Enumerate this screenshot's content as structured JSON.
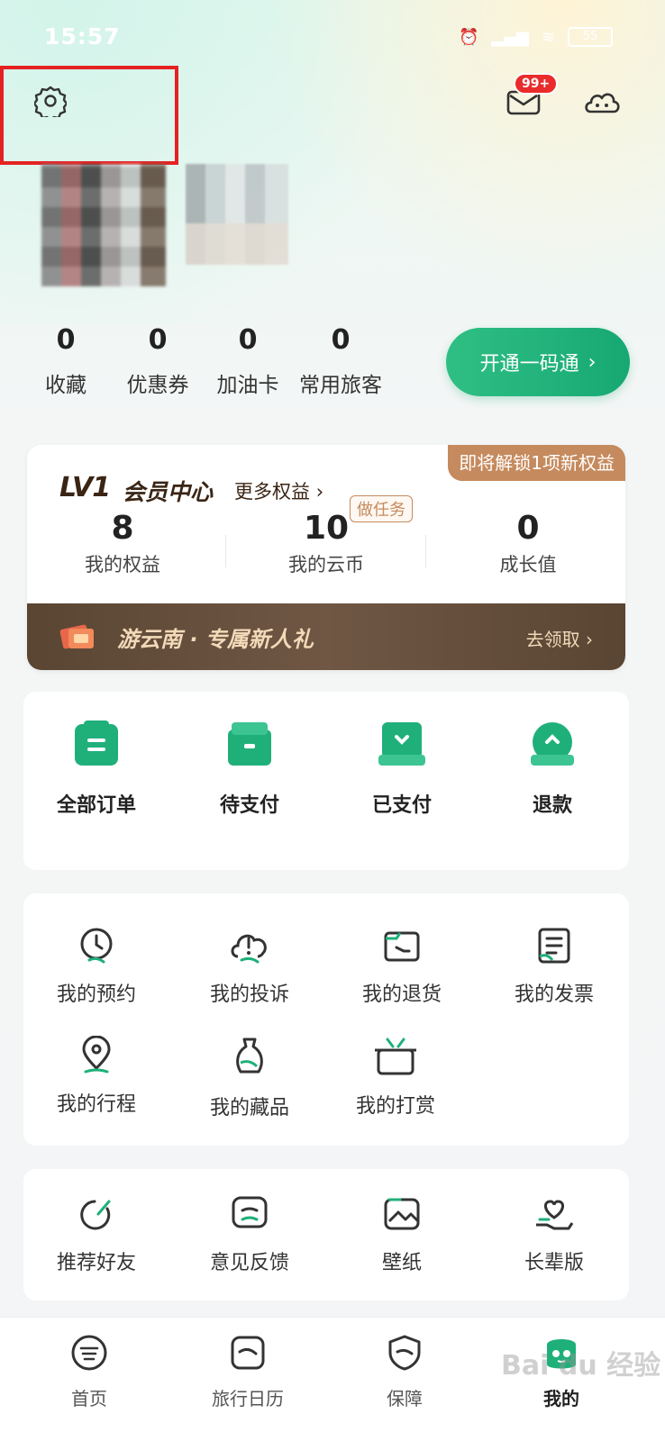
{
  "status": {
    "time": "15:57",
    "battery": "55"
  },
  "header": {
    "mail_badge": "99+"
  },
  "stats": [
    {
      "value": "0",
      "label": "收藏"
    },
    {
      "value": "0",
      "label": "优惠券"
    },
    {
      "value": "0",
      "label": "加油卡"
    },
    {
      "value": "0",
      "label": "常用旅客"
    }
  ],
  "open_button": "开通一码通",
  "member": {
    "unlock_label": "即将解锁1项新权益",
    "level": "LV1",
    "title": "会员中心",
    "more": "更多权益",
    "task_tag": "做任务",
    "columns": [
      {
        "value": "8",
        "label": "我的权益"
      },
      {
        "value": "10",
        "label": "我的云币"
      },
      {
        "value": "0",
        "label": "成长值"
      }
    ],
    "promo_text": "游云南 · 专属新人礼",
    "promo_action": "去领取"
  },
  "orders": [
    {
      "label": "全部订单"
    },
    {
      "label": "待支付"
    },
    {
      "label": "已支付"
    },
    {
      "label": "退款"
    }
  ],
  "services": [
    {
      "label": "我的预约",
      "icon": "clock-icon"
    },
    {
      "label": "我的投诉",
      "icon": "cloud-alert-icon"
    },
    {
      "label": "我的退货",
      "icon": "return-icon"
    },
    {
      "label": "我的发票",
      "icon": "invoice-icon"
    },
    {
      "label": "我的行程",
      "icon": "location-icon"
    },
    {
      "label": "我的藏品",
      "icon": "vase-icon"
    },
    {
      "label": "我的打赏",
      "icon": "tip-box-icon"
    }
  ],
  "more_services": [
    {
      "label": "推荐好友",
      "icon": "share-icon"
    },
    {
      "label": "意见反馈",
      "icon": "feedback-icon"
    },
    {
      "label": "壁纸",
      "icon": "wallpaper-icon"
    },
    {
      "label": "长辈版",
      "icon": "heart-hand-icon"
    }
  ],
  "nav": [
    {
      "label": "首页"
    },
    {
      "label": "旅行日历"
    },
    {
      "label": "保障"
    },
    {
      "label": "我的"
    }
  ],
  "watermark": "Bai du 经验",
  "colors": {
    "accent": "#1fb07a",
    "member_brown": "#c58a5d",
    "badge_red": "#ea2b2b"
  }
}
